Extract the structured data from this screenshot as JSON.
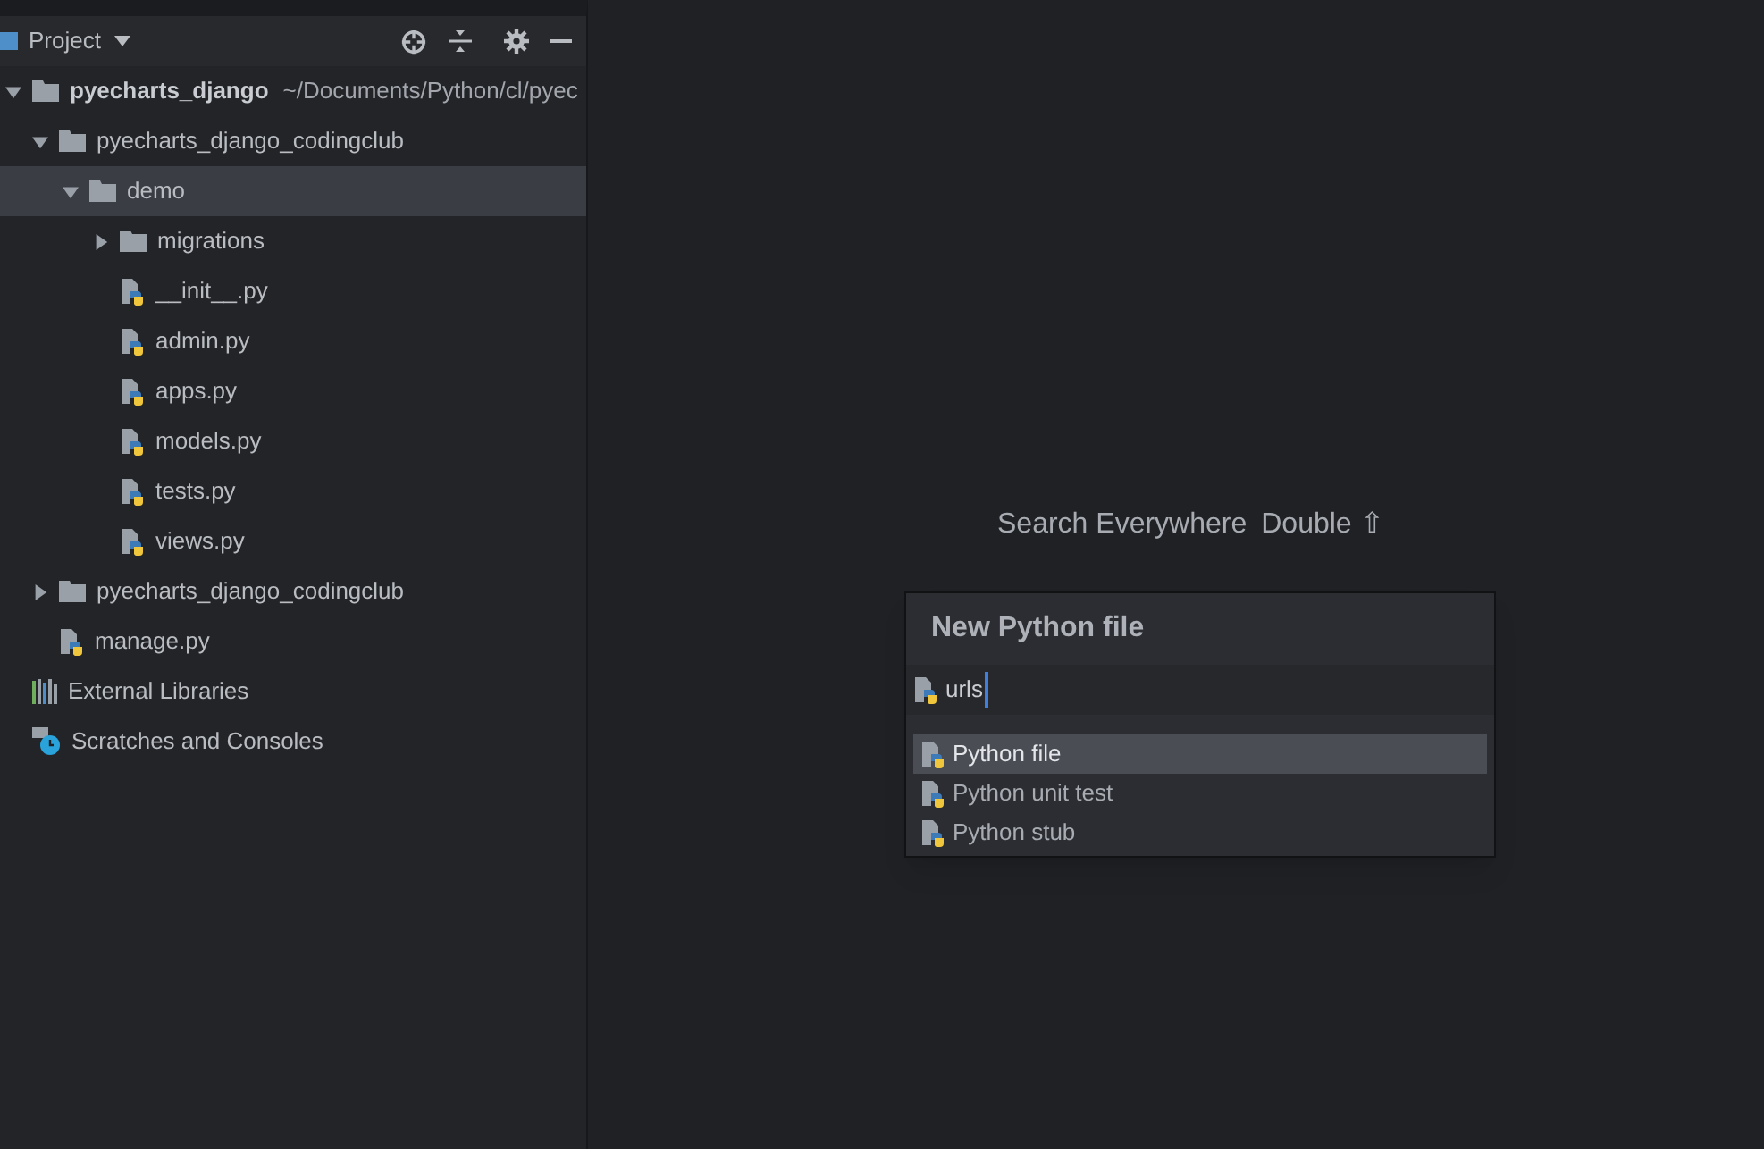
{
  "panel": {
    "title": "Project"
  },
  "tree": [
    {
      "name": "pyecharts_django",
      "path": "~/Documents/Python/cl/pyec",
      "kind": "folder",
      "expanded": true,
      "selected": false,
      "children": [
        {
          "name": "pyecharts_django_codingclub",
          "kind": "folder",
          "expanded": true,
          "selected": false,
          "children": [
            {
              "name": "demo",
              "kind": "folder",
              "expanded": true,
              "selected": true,
              "children": [
                {
                  "name": "migrations",
                  "kind": "folder",
                  "expanded": false,
                  "selected": false
                },
                {
                  "name": "__init__.py",
                  "kind": "python",
                  "selected": false
                },
                {
                  "name": "admin.py",
                  "kind": "python",
                  "selected": false
                },
                {
                  "name": "apps.py",
                  "kind": "python",
                  "selected": false
                },
                {
                  "name": "models.py",
                  "kind": "python",
                  "selected": false
                },
                {
                  "name": "tests.py",
                  "kind": "python",
                  "selected": false
                },
                {
                  "name": "views.py",
                  "kind": "python",
                  "selected": false
                }
              ]
            }
          ]
        },
        {
          "name": "pyecharts_django_codingclub",
          "kind": "folder",
          "expanded": false,
          "selected": false
        },
        {
          "name": "manage.py",
          "kind": "python",
          "selected": false
        }
      ]
    },
    {
      "name": "External Libraries",
      "kind": "libraries",
      "selected": false
    },
    {
      "name": "Scratches and Consoles",
      "kind": "scratches",
      "selected": false
    }
  ],
  "hints": [
    {
      "label": "Search Everywhere",
      "shortcut": "Double ⇧"
    }
  ],
  "dialog": {
    "title": "New Python file",
    "value": "urls",
    "options": [
      {
        "label": "Python file",
        "selected": true
      },
      {
        "label": "Python unit test",
        "selected": false
      },
      {
        "label": "Python stub",
        "selected": false
      }
    ]
  }
}
